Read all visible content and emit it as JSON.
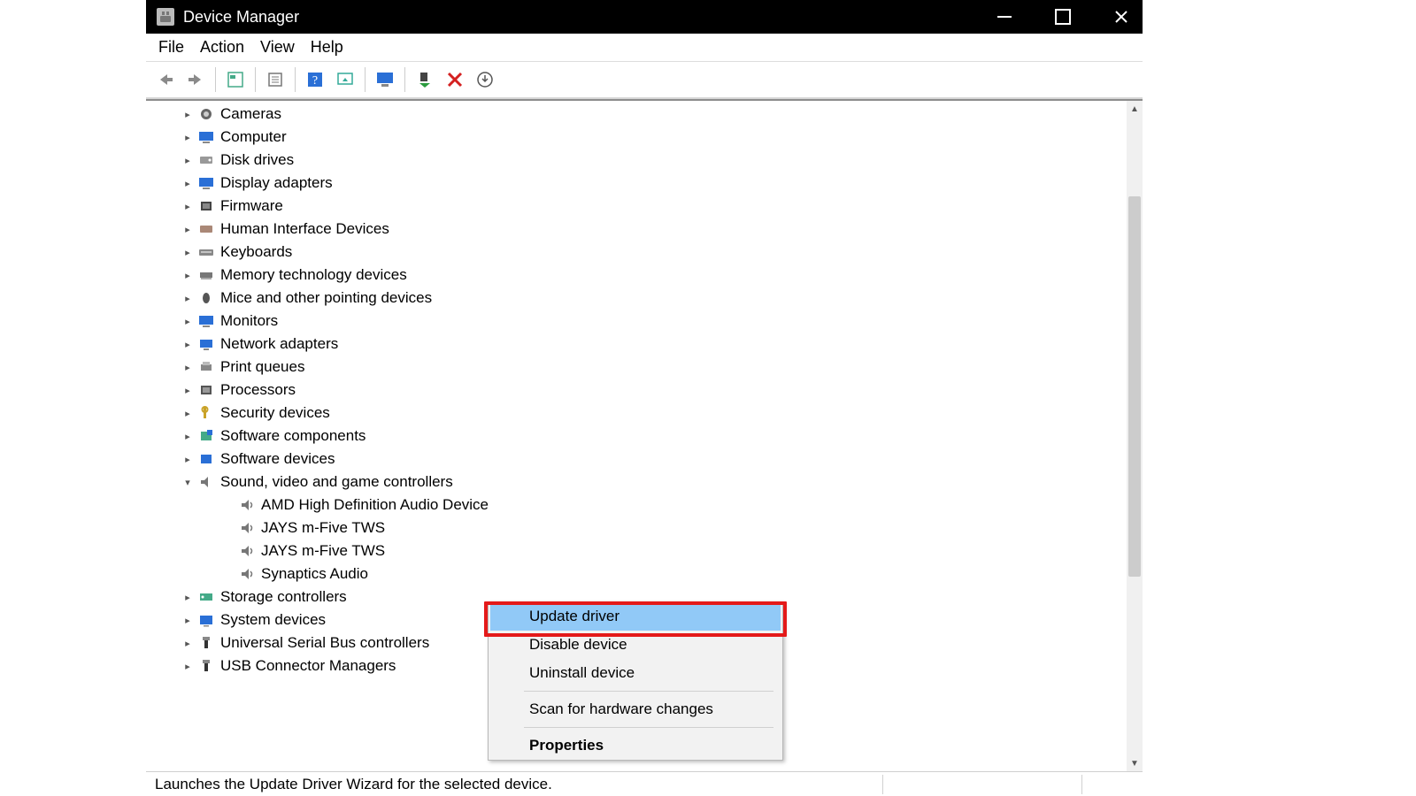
{
  "window": {
    "title": "Device Manager"
  },
  "menubar": [
    "File",
    "Action",
    "View",
    "Help"
  ],
  "toolbar_icons": [
    "back-icon",
    "forward-icon",
    "show-hidden-icon",
    "properties-icon",
    "help-icon",
    "update-drivers-icon",
    "computer-icon",
    "enable-device-icon",
    "disable-device-icon",
    "uninstall-icon"
  ],
  "tree": [
    {
      "label": "Cameras",
      "icon": "camera"
    },
    {
      "label": "Computer",
      "icon": "monitor"
    },
    {
      "label": "Disk drives",
      "icon": "disk"
    },
    {
      "label": "Display adapters",
      "icon": "monitor"
    },
    {
      "label": "Firmware",
      "icon": "chip"
    },
    {
      "label": "Human Interface Devices",
      "icon": "hid"
    },
    {
      "label": "Keyboards",
      "icon": "keyboard"
    },
    {
      "label": "Memory technology devices",
      "icon": "memory"
    },
    {
      "label": "Mice and other pointing devices",
      "icon": "mouse"
    },
    {
      "label": "Monitors",
      "icon": "monitor"
    },
    {
      "label": "Network adapters",
      "icon": "network"
    },
    {
      "label": "Print queues",
      "icon": "printer"
    },
    {
      "label": "Processors",
      "icon": "cpu"
    },
    {
      "label": "Security devices",
      "icon": "security"
    },
    {
      "label": "Software components",
      "icon": "softcomp"
    },
    {
      "label": "Software devices",
      "icon": "softdev"
    },
    {
      "label": "Sound, video and game controllers",
      "icon": "sound",
      "expanded": true,
      "children": [
        {
          "label": "AMD High Definition Audio Device",
          "icon": "speaker",
          "selected": true
        },
        {
          "label": "JAYS m-Five TWS",
          "icon": "speaker"
        },
        {
          "label": "JAYS m-Five TWS",
          "icon": "speaker"
        },
        {
          "label": "Synaptics Audio",
          "icon": "speaker"
        }
      ]
    },
    {
      "label": "Storage controllers",
      "icon": "storage"
    },
    {
      "label": "System devices",
      "icon": "system"
    },
    {
      "label": "Universal Serial Bus controllers",
      "icon": "usb"
    },
    {
      "label": "USB Connector Managers",
      "icon": "usbconn"
    }
  ],
  "context_menu": {
    "items": [
      {
        "label": "Update driver",
        "highlight": true
      },
      {
        "label": "Disable device"
      },
      {
        "label": "Uninstall device"
      },
      {
        "sep": true
      },
      {
        "label": "Scan for hardware changes"
      },
      {
        "sep": true
      },
      {
        "label": "Properties",
        "bold": true
      }
    ]
  },
  "statusbar": {
    "text": "Launches the Update Driver Wizard for the selected device."
  }
}
